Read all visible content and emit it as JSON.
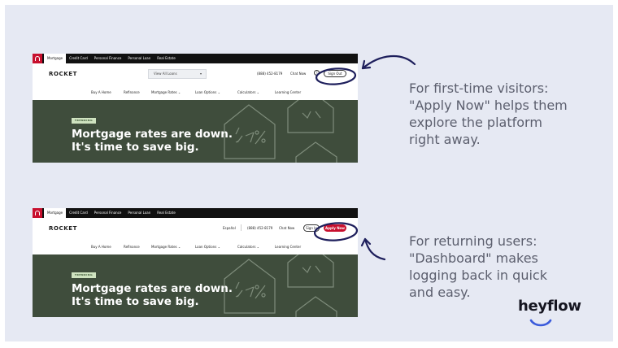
{
  "screenshot_first": {
    "topnav": [
      "Mortgage",
      "Credit Card",
      "Personal Finance",
      "Personal Loan",
      "Real Estate"
    ],
    "logo": "ROCKET",
    "loans_select": "View All Loans",
    "phone": "(888) 452-8179",
    "chat": "Chat Now",
    "sign_out": "Sign Out",
    "nav": [
      "Buy A Home",
      "Refinance",
      "Mortgage Rates ⌄",
      "Loan Options ⌄",
      "Calculators ⌄",
      "Learning Center"
    ],
    "trending": "TRENDING",
    "headline_1": "Mortgage rates are down.",
    "headline_2": "It's time to save big."
  },
  "screenshot_returning": {
    "topnav": [
      "Mortgage",
      "Credit Card",
      "Personal Finance",
      "Personal Loan",
      "Real Estate"
    ],
    "logo": "ROCKET",
    "language": "Español",
    "phone": "(888) 452-8179",
    "chat": "Chat Now",
    "sign_in": "Sign In",
    "apply_now": "Apply Now",
    "nav": [
      "Buy A Home",
      "Refinance",
      "Mortgage Rates ⌄",
      "Loan Options ⌄",
      "Calculators ⌄",
      "Learning Center"
    ],
    "trending": "TRENDING",
    "headline_1": "Mortgage rates are down.",
    "headline_2": "It's time to save big."
  },
  "callouts": {
    "first": [
      "For first-time visitors:",
      "\"Apply Now\" helps them",
      "explore the platform",
      "right away."
    ],
    "returning": [
      "For returning users:",
      "\"Dashboard\" makes",
      "logging back in quick",
      "and easy."
    ]
  },
  "brand": "heyflow",
  "colors": {
    "background": "#e6e9f3",
    "annotation": "#1e1f5c",
    "hero_green": "#3f4d3c",
    "brand_red": "#c8102e",
    "callout_text": "#5c5f6e"
  }
}
